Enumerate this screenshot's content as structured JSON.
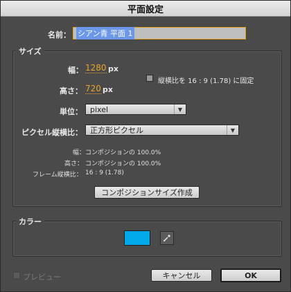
{
  "window": {
    "title": "平面設定"
  },
  "name": {
    "label": "名前：",
    "value": "シアン青 平面 1"
  },
  "size": {
    "group_label": "サイズ",
    "width_label": "幅：",
    "width_value": "1280",
    "width_unit": "px",
    "height_label": "高さ：",
    "height_value": "720",
    "height_unit": "px",
    "lock_aspect_label": "縦横比を 16 : 9 (1.78) に固定",
    "unit_label": "単位：",
    "unit_value": "pixel",
    "pixel_aspect_label": "ピクセル縦横比：",
    "pixel_aspect_value": "正方形ピクセル",
    "info": {
      "width_label": "幅：",
      "width_value": "コンポジションの 100.0%",
      "height_label": "高さ：",
      "height_value": "コンポジションの 100.0%",
      "frame_aspect_label": "フレーム縦横比：",
      "frame_aspect_value": "16 : 9 (1.78)"
    },
    "make_comp_size_button": "コンポジションサイズ作成"
  },
  "color": {
    "group_label": "カラー",
    "swatch_hex": "#00a9e8",
    "eyedropper_icon": "eyedropper-icon"
  },
  "footer": {
    "preview_label": "プレビュー",
    "cancel_button": "キャンセル",
    "ok_button": "OK"
  }
}
